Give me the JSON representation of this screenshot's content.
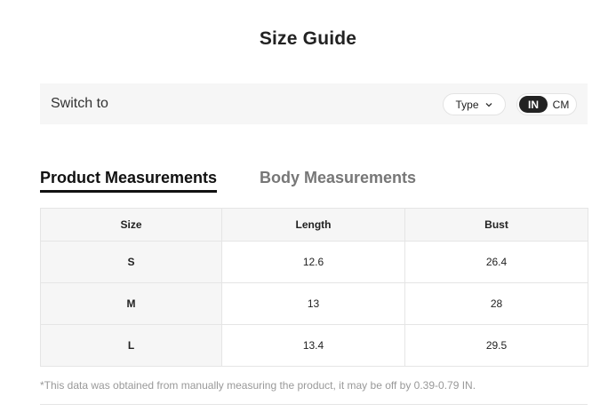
{
  "title": "Size Guide",
  "switch_bar": {
    "label": "Switch to",
    "type_button": {
      "label": "Type",
      "icon": "chevron-down-icon"
    },
    "unit_toggle": {
      "options": [
        "IN",
        "CM"
      ],
      "selected": "IN"
    }
  },
  "tabs": [
    {
      "label": "Product Measurements",
      "active": true
    },
    {
      "label": "Body Measurements",
      "active": false
    }
  ],
  "table": {
    "headers": [
      "Size",
      "Length",
      "Bust"
    ],
    "rows": [
      [
        "S",
        "12.6",
        "26.4"
      ],
      [
        "M",
        "13",
        "28"
      ],
      [
        "L",
        "13.4",
        "29.5"
      ]
    ]
  },
  "note": "*This data was obtained from manually measuring the product, it may be off by 0.39-0.79 IN."
}
